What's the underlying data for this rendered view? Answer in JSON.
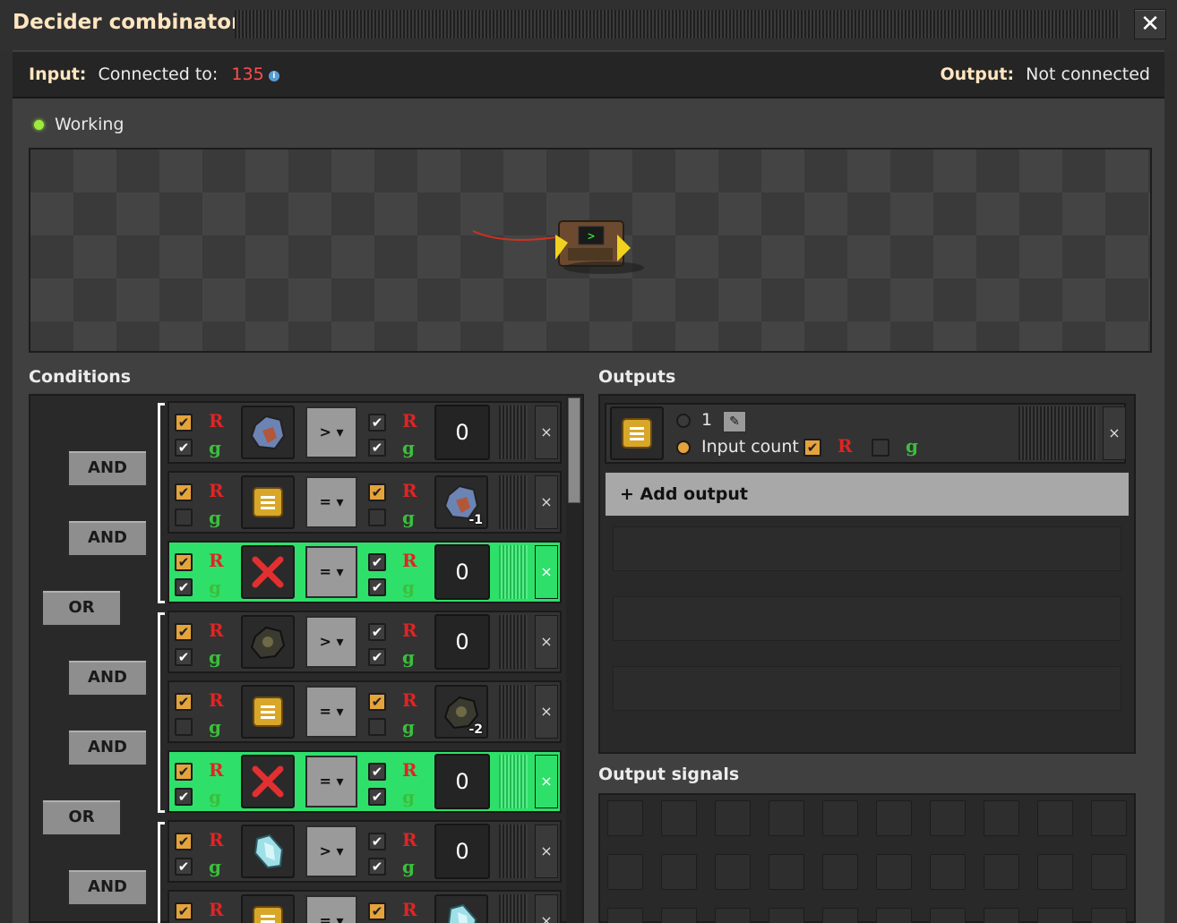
{
  "window": {
    "title": "Decider combinator",
    "close_label": "✕"
  },
  "connection": {
    "input_label": "Input:",
    "input_text": "Connected to:",
    "input_network": "135",
    "output_label": "Output:",
    "output_text": "Not connected"
  },
  "status": {
    "text": "Working",
    "color": "#9eea3b"
  },
  "sections": {
    "conditions": "Conditions",
    "outputs": "Outputs",
    "output_signals": "Output signals"
  },
  "logic": {
    "and": "AND",
    "or": "OR"
  },
  "conditions": [
    {
      "left_red": true,
      "left_green": true,
      "signal": "iron-ore-icon",
      "op": ">",
      "right_red": true,
      "right_green": true,
      "value": "0",
      "value_kind": "const",
      "highlight": false
    },
    {
      "left_red": true,
      "left_green": false,
      "signal": "each-signal-icon",
      "op": "=",
      "right_red": true,
      "right_green": false,
      "value": "-1",
      "value_kind": "signal",
      "value_icon": "iron-ore-icon",
      "highlight": false
    },
    {
      "left_red": true,
      "left_green": true,
      "signal": "deny-icon",
      "op": "=",
      "right_red": true,
      "right_green": true,
      "value": "0",
      "value_kind": "const",
      "highlight": true
    },
    {
      "left_red": true,
      "left_green": true,
      "signal": "coal-icon",
      "op": ">",
      "right_red": true,
      "right_green": true,
      "value": "0",
      "value_kind": "const",
      "highlight": false
    },
    {
      "left_red": true,
      "left_green": false,
      "signal": "each-signal-icon",
      "op": "=",
      "right_red": true,
      "right_green": false,
      "value": "-2",
      "value_kind": "signal",
      "value_icon": "coal-icon",
      "highlight": false
    },
    {
      "left_red": true,
      "left_green": true,
      "signal": "deny-icon",
      "op": "=",
      "right_red": true,
      "right_green": true,
      "value": "0",
      "value_kind": "const",
      "highlight": true
    },
    {
      "left_red": true,
      "left_green": true,
      "signal": "ice-icon",
      "op": ">",
      "right_red": true,
      "right_green": true,
      "value": "0",
      "value_kind": "const",
      "highlight": false
    },
    {
      "left_red": true,
      "left_green": false,
      "signal": "each-signal-icon",
      "op": "=",
      "right_red": true,
      "right_green": false,
      "value": "",
      "value_kind": "signal",
      "value_icon": "ice-icon",
      "highlight": false
    }
  ],
  "output": {
    "signal": "each-signal-icon",
    "constant_value": "1",
    "input_count_label": "Input count",
    "red_checked": true,
    "green_checked": false,
    "add_label": "+ Add output"
  },
  "colors": {
    "accent_green": "#2ee06a",
    "orange": "#e5a33b",
    "red_wire": "#e02424",
    "green_wire": "#3bbf3b"
  }
}
